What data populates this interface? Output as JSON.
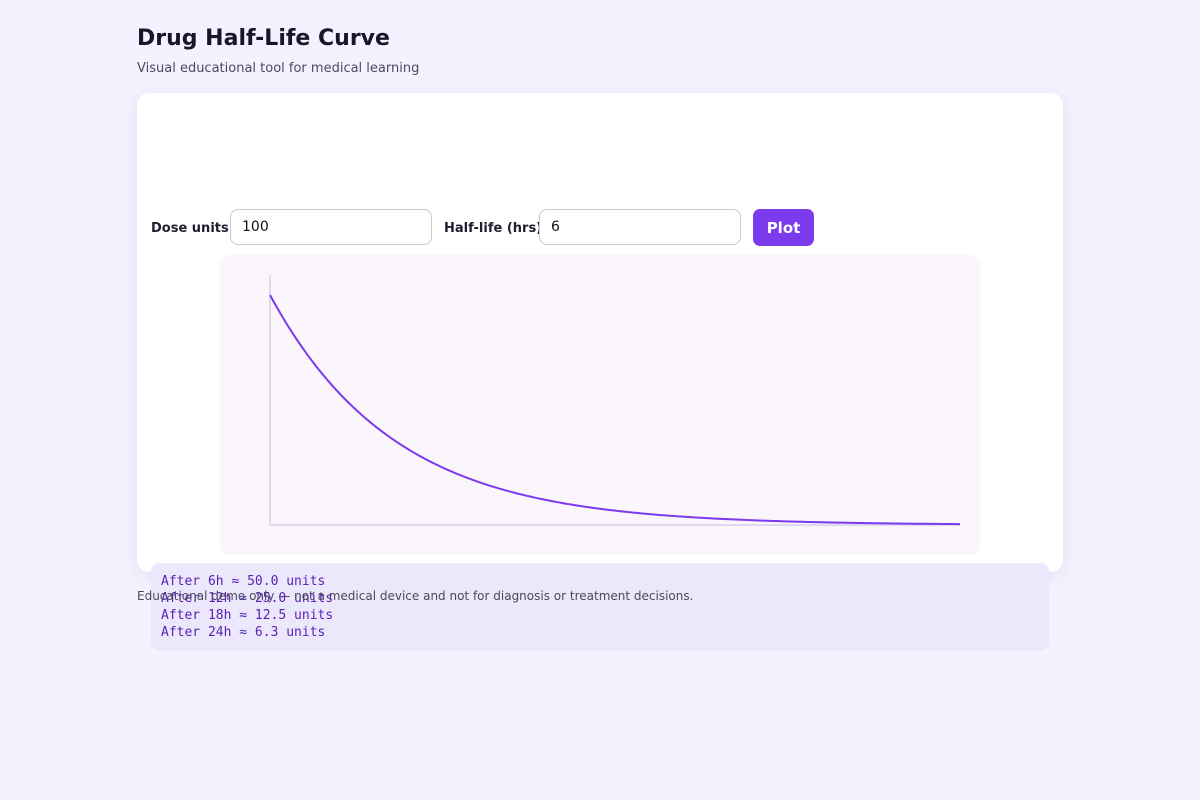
{
  "header": {
    "title": "Drug Half-Life Curve",
    "subtitle": "Visual educational tool for medical learning"
  },
  "controls": {
    "dose_label": "Dose units",
    "dose_value": "100",
    "halflife_label": "Half-life (hrs)",
    "halflife_value": "6",
    "plot_label": "Plot"
  },
  "chart_data": {
    "type": "line",
    "title": "",
    "xlabel": "",
    "ylabel": "",
    "grid": false,
    "color": "#7c3aed",
    "axis_color": "#d9d0ec",
    "dose": 100,
    "half_life_hours": 6,
    "xlim": [
      0,
      48
    ],
    "ylim": [
      0,
      100
    ],
    "series": [
      {
        "x": [
          0,
          3,
          6,
          9,
          12,
          15,
          18,
          21,
          24,
          27,
          30,
          33,
          36,
          39,
          42,
          45,
          48
        ],
        "values": [
          100,
          70.7,
          50.0,
          35.4,
          25.0,
          17.7,
          12.5,
          8.8,
          6.3,
          4.4,
          3.1,
          2.2,
          1.6,
          1.1,
          0.8,
          0.6,
          0.4
        ]
      }
    ]
  },
  "results": [
    "After 6h ≈ 50.0 units",
    "After 12h ≈ 25.0 units",
    "After 18h ≈ 12.5 units",
    "After 24h ≈ 6.3 units"
  ],
  "footer": {
    "disclaimer": "Educational demo only — not a medical device and not for diagnosis or treatment decisions."
  },
  "colors": {
    "background": "#f4f2fe",
    "accent": "#7c3aed",
    "results_background": "#ece8fc",
    "results_text": "#5b21b6",
    "chart_background": "#fbf5fc"
  }
}
